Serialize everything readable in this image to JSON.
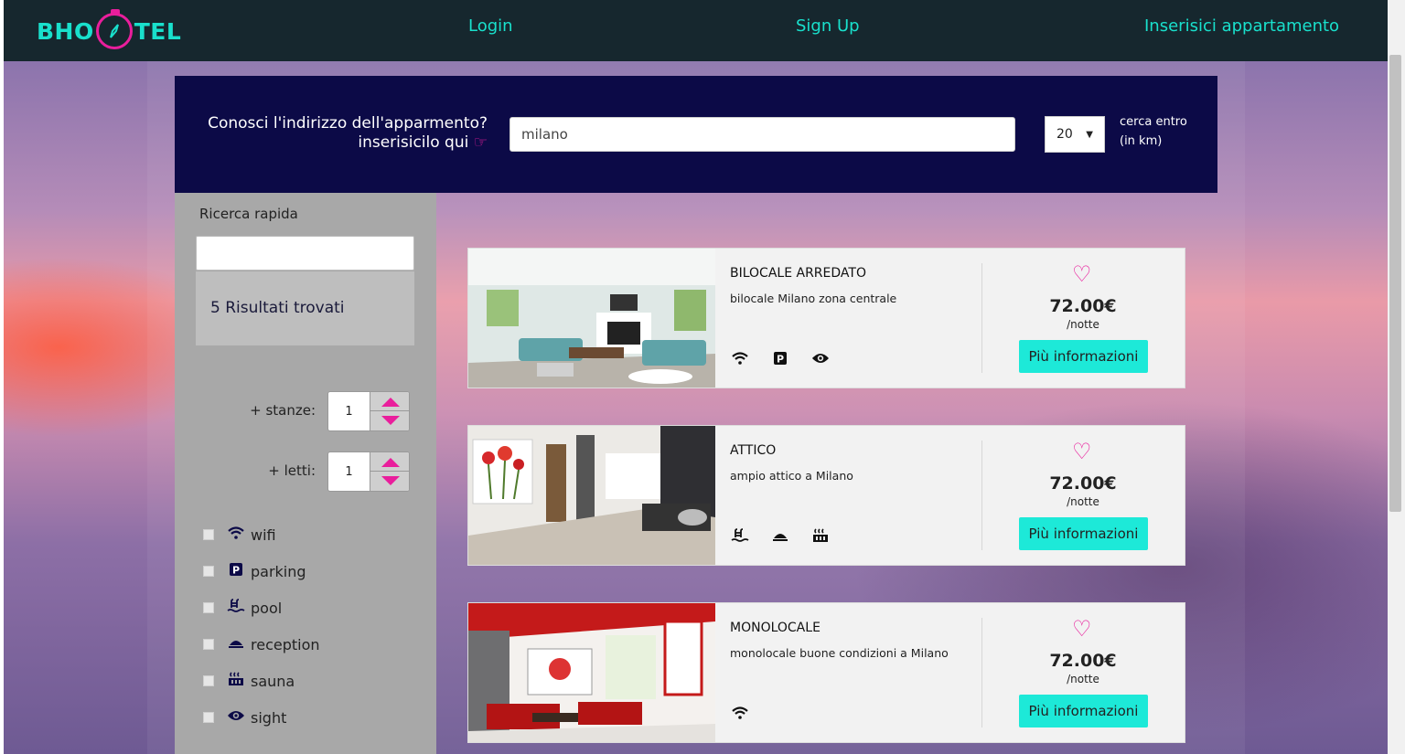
{
  "header": {
    "logo_left": "BHO",
    "logo_right": "TEL",
    "nav": {
      "login": "Login",
      "signup": "Sign Up",
      "insert": "Inserisici appartamento"
    }
  },
  "search": {
    "question_line1": "Conosci l'indirizzo dell'apparmento?",
    "question_line2": "inserisicilo qui",
    "value": "milano",
    "radius": "20",
    "radius_label_line1": "cerca entro",
    "radius_label_line2": "(in km)"
  },
  "sidebar": {
    "title": "Ricerca rapida",
    "results": "5 Risultati trovati",
    "rooms_label": "+ stanze:",
    "rooms_value": "1",
    "beds_label": "+ letti:",
    "beds_value": "1",
    "features": [
      {
        "label": "wifi",
        "icon": "wifi-icon"
      },
      {
        "label": "parking",
        "icon": "parking-icon"
      },
      {
        "label": "pool",
        "icon": "pool-icon"
      },
      {
        "label": "reception",
        "icon": "reception-icon"
      },
      {
        "label": "sauna",
        "icon": "sauna-icon"
      },
      {
        "label": "sight",
        "icon": "eye-icon"
      }
    ]
  },
  "listings": [
    {
      "title": "BILOCALE ARREDATO",
      "description": "bilocale Milano zona centrale",
      "amenities": [
        "wifi-icon",
        "parking-icon",
        "eye-icon"
      ],
      "price": "72.00€",
      "per": "/notte",
      "button": "Più informazioni"
    },
    {
      "title": "ATTICO",
      "description": "ampio attico a Milano",
      "amenities": [
        "pool-icon",
        "reception-icon",
        "sauna-icon"
      ],
      "price": "72.00€",
      "per": "/notte",
      "button": "Più informazioni"
    },
    {
      "title": "MONOLOCALE",
      "description": "monolocale buone condizioni a Milano",
      "amenities": [
        "wifi-icon"
      ],
      "price": "72.00€",
      "per": "/notte",
      "button": "Più informazioni"
    }
  ],
  "colors": {
    "accent": "#19e0cc",
    "brand_pink": "#e91e9c",
    "navy": "#0c0a47",
    "button": "#1de9d8"
  }
}
